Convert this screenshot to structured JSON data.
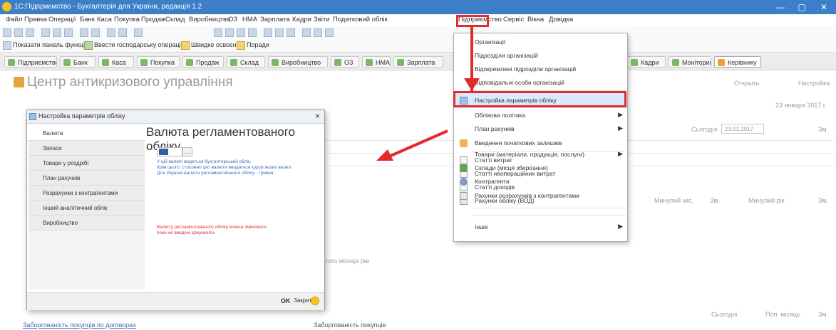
{
  "window": {
    "title": "1С:Підприємство - Бухгалтерія для України, редакція 1.2",
    "minimize": "—",
    "maximize": "▢",
    "close": "✕"
  },
  "menubar": [
    "Файл",
    "Правка",
    "Операції",
    "Банк",
    "Каса",
    "Покупка",
    "Продаж",
    "Склад",
    "Виробництво",
    "ОЗ",
    "НМА",
    "Зарплата",
    "Кадри",
    "Звіти",
    "Податковий облік",
    "Підприємство",
    "Сервіс",
    "Вікна",
    "Довідка"
  ],
  "toolbar2": {
    "item1": "Показати панель функцій",
    "item2": "Ввести господарську операцію",
    "item3": "Швидке освоєння",
    "item4": "Поради"
  },
  "tabs": [
    "Підприємство",
    "Банк",
    "Каса",
    "Покупка",
    "Продаж",
    "Склад",
    "Виробництво",
    "ОЗ",
    "НМА",
    "Зарплата",
    "Кадри",
    "Моніторинг",
    "Керівнику"
  ],
  "page": {
    "title": "Центр антикризового управління",
    "open_label": "Открыть",
    "settings_label": "Настройка",
    "date_text": "23 января 2017 г.",
    "date_field": "23.01.2017",
    "today_label": "Сьогодні",
    "col1": "Минулий міс.",
    "col2": "Зм.",
    "col3": "Минулий рік",
    "col4": "Зм.",
    "today_label2": "Сьогодні",
    "prev_month": "Поп. місяць",
    "col5": "Зм.",
    "debt_label": "Заборгованість покупців",
    "link_label": "Заборгованість покупців по договорах",
    "month_label": "того місяця (ве"
  },
  "menu": {
    "items": [
      {
        "label": "Організації",
        "submenu": false
      },
      {
        "label": "Підрозділи організацій",
        "submenu": false
      },
      {
        "label": "Відокремлені підрозділи організацій",
        "submenu": false
      },
      {
        "label": "Відповідальні особи організацій",
        "submenu": false
      },
      {
        "label": "Настройка параметрів обліку",
        "submenu": false
      },
      {
        "label": "Облікова політика",
        "submenu": true
      },
      {
        "label": "План рахунків",
        "submenu": true
      },
      {
        "label": "Введення початкових залишків",
        "submenu": false
      },
      {
        "label": "Статті витрат",
        "submenu": false
      },
      {
        "label": "Статті неопераційних витрат",
        "submenu": false
      },
      {
        "label": "Статті доходів",
        "submenu": false
      },
      {
        "label": "Рахунки обліку (ВОД)",
        "submenu": false
      },
      {
        "label": "Товари (матеріали, продукція, послуги)",
        "submenu": true
      },
      {
        "label": "Склади (місця зберігання)",
        "submenu": false
      },
      {
        "label": "Контрагенти",
        "submenu": false
      },
      {
        "label": "Рахунки розрахунків з контрагентами",
        "submenu": false
      },
      {
        "label": "Інше",
        "submenu": true
      }
    ],
    "arrow": "▶"
  },
  "dialog": {
    "title": "Настройка параметрів обліку",
    "close": "×",
    "sections": [
      "Валюта",
      "Запаси",
      "Товари у роздрібі",
      "План рахунків",
      "Розрахунки з контрагентами",
      "Інший аналітичний облік",
      "Виробництво"
    ],
    "heading": "Валюта регламентованого обліку",
    "select_glyph": "...",
    "note1": "У цій валюті ведеться бухгалтерський облік.",
    "note2": "Крім цього, стосовно цієї валюти вводяться курси інших валют.",
    "note3": "Для України валюта регламентованого обліку - гривня.",
    "warn1": "Валюту регламентованого обліку можна змінювати",
    "warn2": "поки не введені документи.",
    "ok": "OK",
    "close_label": "Закрити"
  },
  "colors": {
    "accent_red": "#e32b2b",
    "title_blue": "#3c7fc8",
    "note_blue": "#3a6fb7",
    "warn_red": "#d33333"
  }
}
